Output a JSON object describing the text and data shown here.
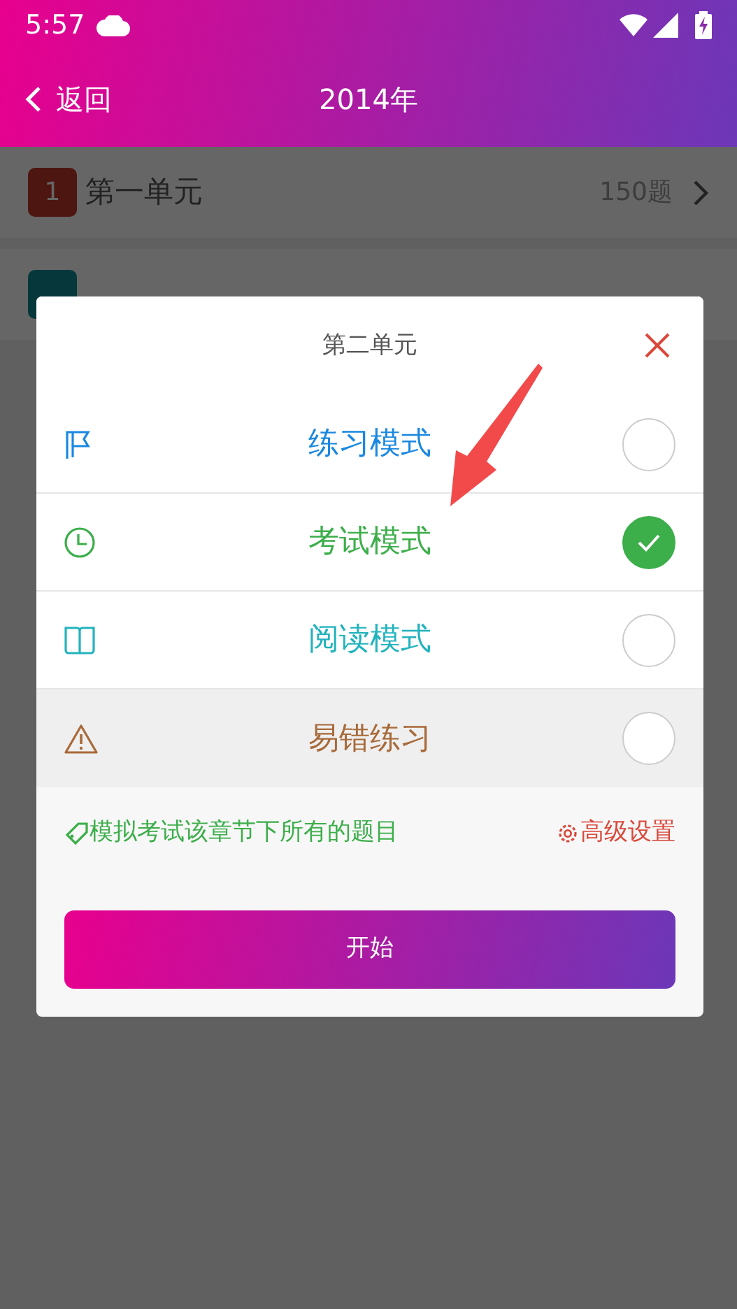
{
  "status_bar": {
    "time": "5:57"
  },
  "header": {
    "back": "返回",
    "title": "2014年"
  },
  "units": [
    {
      "number": "1",
      "name": "第一单元",
      "count": "150题"
    }
  ],
  "dialog": {
    "title": "第二单元",
    "modes": [
      {
        "kind": "flag",
        "label": "练习模式",
        "color": "#1a88e0",
        "selected": false,
        "highlighted": false
      },
      {
        "kind": "clock",
        "label": "考试模式",
        "color": "#3cae4a",
        "selected": true,
        "highlighted": false
      },
      {
        "kind": "book",
        "label": "阅读模式",
        "color": "#22b3bd",
        "selected": false,
        "highlighted": false
      },
      {
        "kind": "warning",
        "label": "易错练习",
        "color": "#a86a3a",
        "selected": false,
        "highlighted": true
      }
    ],
    "hint": "模拟考试该章节下所有的题目",
    "settings": "高级设置",
    "start": "开始"
  }
}
